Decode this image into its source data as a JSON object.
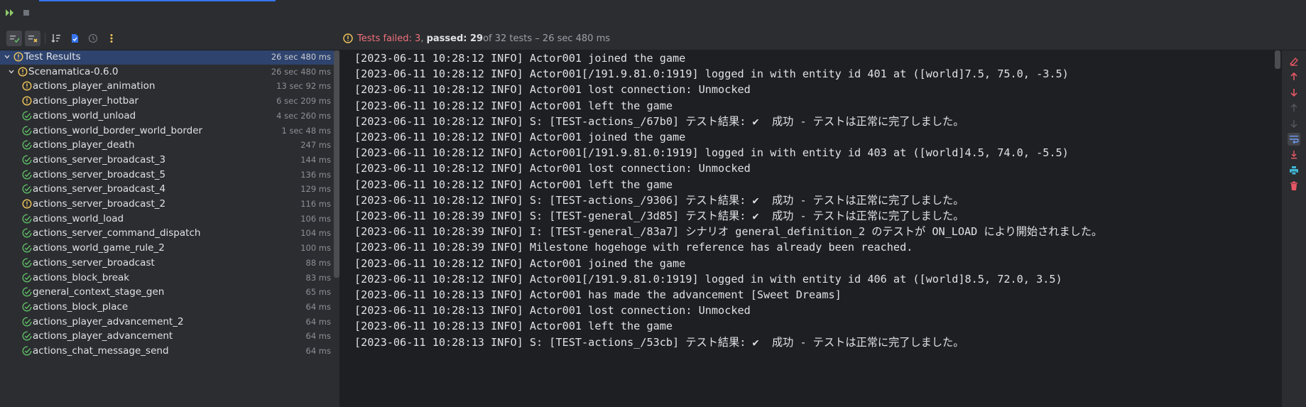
{
  "status": {
    "failed_label": "Tests failed: 3",
    "passed_label": "passed: 29",
    "rest_label": " of 32 tests – 26 sec 480 ms"
  },
  "tree": [
    {
      "label": "Test Results",
      "duration": "26 sec 480 ms",
      "icon": "warning-icon"
    },
    {
      "label": "Scenamatica-0.6.0",
      "duration": "26 sec 480 ms",
      "icon": "warning-icon"
    },
    {
      "label": "actions_player_animation",
      "duration": "13 sec 92 ms",
      "icon": "warning-icon"
    },
    {
      "label": "actions_player_hotbar",
      "duration": "6 sec 209 ms",
      "icon": "warning-icon"
    },
    {
      "label": "actions_world_unload",
      "duration": "4 sec 260 ms",
      "icon": "check-icon"
    },
    {
      "label": "actions_world_border_world_border",
      "duration": "1 sec 48 ms",
      "icon": "check-icon"
    },
    {
      "label": "actions_player_death",
      "duration": "247 ms",
      "icon": "check-icon"
    },
    {
      "label": "actions_server_broadcast_3",
      "duration": "144 ms",
      "icon": "check-icon"
    },
    {
      "label": "actions_server_broadcast_5",
      "duration": "136 ms",
      "icon": "check-icon"
    },
    {
      "label": "actions_server_broadcast_4",
      "duration": "129 ms",
      "icon": "check-icon"
    },
    {
      "label": "actions_server_broadcast_2",
      "duration": "116 ms",
      "icon": "warning-icon"
    },
    {
      "label": "actions_world_load",
      "duration": "106 ms",
      "icon": "check-icon"
    },
    {
      "label": "actions_server_command_dispatch",
      "duration": "104 ms",
      "icon": "check-icon"
    },
    {
      "label": "actions_world_game_rule_2",
      "duration": "100 ms",
      "icon": "check-icon"
    },
    {
      "label": "actions_server_broadcast",
      "duration": "88 ms",
      "icon": "check-icon"
    },
    {
      "label": "actions_block_break",
      "duration": "83 ms",
      "icon": "check-icon"
    },
    {
      "label": "general_context_stage_gen",
      "duration": "65 ms",
      "icon": "check-icon"
    },
    {
      "label": "actions_block_place",
      "duration": "64 ms",
      "icon": "check-icon"
    },
    {
      "label": "actions_player_advancement_2",
      "duration": "64 ms",
      "icon": "check-icon"
    },
    {
      "label": "actions_player_advancement",
      "duration": "64 ms",
      "icon": "check-icon"
    },
    {
      "label": "actions_chat_message_send",
      "duration": "64 ms",
      "icon": "check-icon"
    }
  ],
  "console": [
    "[2023-06-11 10:28:12 INFO] Actor001 joined the game",
    "[2023-06-11 10:28:12 INFO] Actor001[/191.9.81.0:1919] logged in with entity id 401 at ([world]7.5, 75.0, -3.5)",
    "[2023-06-11 10:28:12 INFO] Actor001 lost connection: Unmocked",
    "[2023-06-11 10:28:12 INFO] Actor001 left the game",
    "[2023-06-11 10:28:12 INFO] S: [TEST-actions_/67b0] テスト結果: ✔  成功 - テストは正常に完了しました。",
    "[2023-06-11 10:28:12 INFO] Actor001 joined the game",
    "[2023-06-11 10:28:12 INFO] Actor001[/191.9.81.0:1919] logged in with entity id 403 at ([world]4.5, 74.0, -5.5)",
    "[2023-06-11 10:28:12 INFO] Actor001 lost connection: Unmocked",
    "[2023-06-11 10:28:12 INFO] Actor001 left the game",
    "[2023-06-11 10:28:12 INFO] S: [TEST-actions_/9306] テスト結果: ✔  成功 - テストは正常に完了しました。",
    "[2023-06-11 10:28:39 INFO] S: [TEST-general_/3d85] テスト結果: ✔  成功 - テストは正常に完了しました。",
    "[2023-06-11 10:28:39 INFO] I: [TEST-general_/83a7] シナリオ general_definition_2 のテストが ON_LOAD により開始されました。",
    "[2023-06-11 10:28:39 INFO] Milestone hogehoge with reference has already been reached.",
    "[2023-06-11 10:28:12 INFO] Actor001 joined the game",
    "[2023-06-11 10:28:12 INFO] Actor001[/191.9.81.0:1919] logged in with entity id 406 at ([world]8.5, 72.0, 3.5)",
    "[2023-06-11 10:28:13 INFO] Actor001 has made the advancement [Sweet Dreams]",
    "[2023-06-11 10:28:13 INFO] Actor001 lost connection: Unmocked",
    "[2023-06-11 10:28:13 INFO] Actor001 left the game",
    "[2023-06-11 10:28:13 INFO] S: [TEST-actions_/53cb] テスト結果: ✔  成功 - テストは正常に完了しました。"
  ],
  "colors": {
    "warning": "#f2c55c",
    "success": "#5fb865",
    "failed_text": "#f0707b",
    "selection": "#2e436e",
    "accent": "#3574f0",
    "danger": "#e55765",
    "print": "#3fb6d4"
  }
}
